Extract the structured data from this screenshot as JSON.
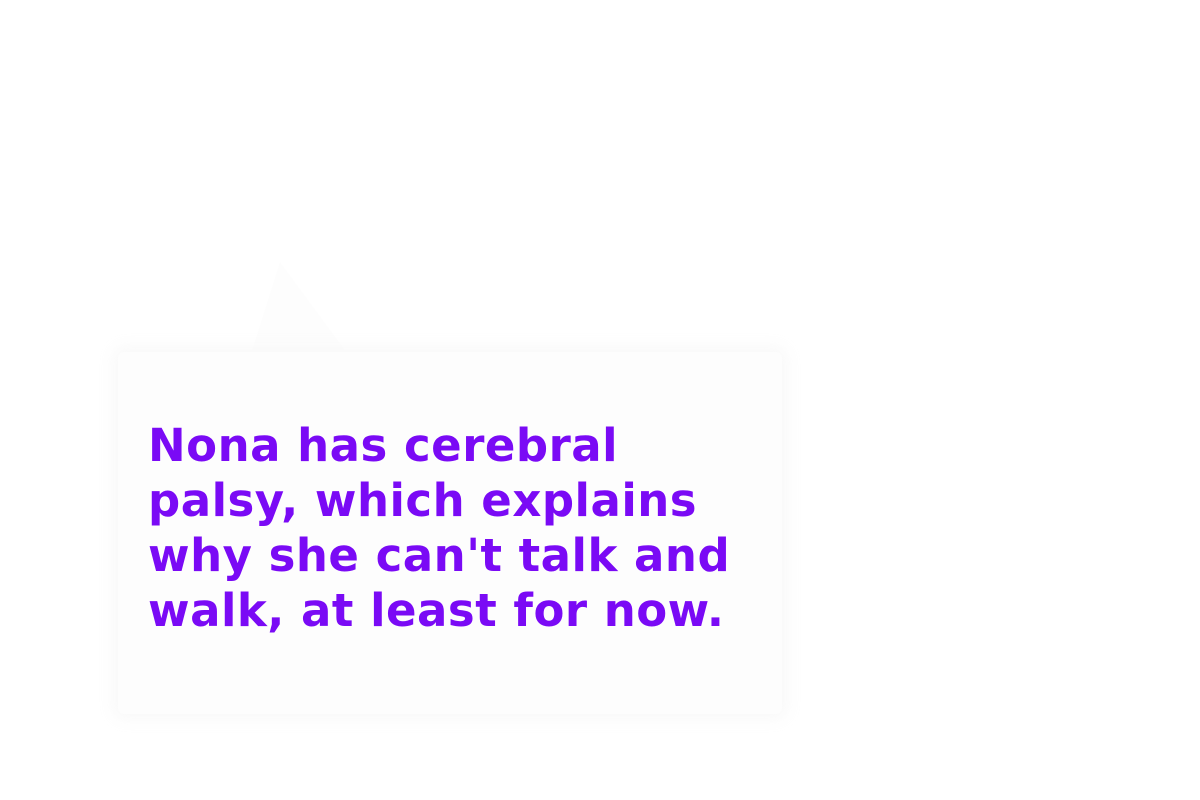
{
  "caption": {
    "text": "Nona has cerebral\npalsy, which explains\nwhy she can't talk and\nwalk, at least for now.",
    "color": "#7a0af5"
  },
  "speech_bubble": {
    "background": "#fdfdfd"
  }
}
